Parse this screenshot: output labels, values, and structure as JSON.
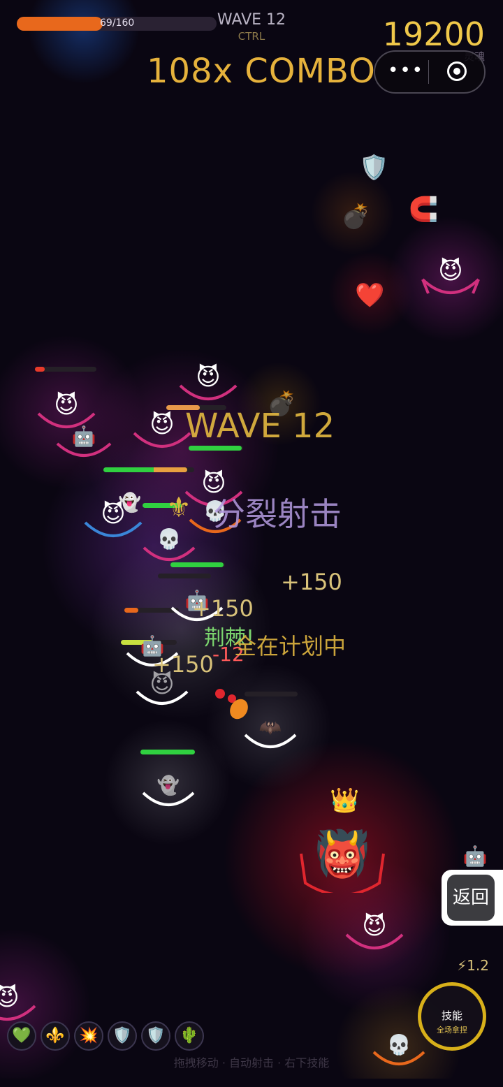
{
  "hud": {
    "hp_text": "69/160",
    "hp_fraction": 0.431,
    "wave_label": "WAVE 12",
    "wave_sub": "CTRL",
    "score": "19200",
    "score_unit": "灵魂",
    "combo": "108x COMBO"
  },
  "capsule": {
    "more_icon": "•••",
    "target_icon": "record-icon"
  },
  "floating": {
    "wave_banner": "WAVE 12",
    "skill_name": "分裂射击",
    "plus_a": "+150",
    "plus_b": "+150",
    "plus_c": "+150",
    "thorn": "荆棘!",
    "damage": "-12",
    "plan": "全在计划中"
  },
  "enemies": {
    "devil": "😈",
    "robot": "🤖",
    "skull": "💀",
    "ghost": "👻",
    "bat": "🦇",
    "boss": "👹",
    "crown": "👑"
  },
  "pickups": {
    "shield": "🛡️",
    "bomb": "💣",
    "magnet": "🧲",
    "heart": "❤️"
  },
  "skills_bar": [
    {
      "icon": "💚",
      "name": "heal"
    },
    {
      "icon": "⚜️",
      "name": "split"
    },
    {
      "icon": "💥",
      "name": "explode"
    },
    {
      "icon": "🛡️",
      "name": "shield"
    },
    {
      "icon": "🛡️",
      "name": "shield-2"
    },
    {
      "icon": "🌵",
      "name": "thorns"
    }
  ],
  "hint": "拖拽移动 · 自动射击 · 右下技能",
  "energy": "⚡1.2",
  "skill_button": {
    "line1": "技能",
    "line2": "全场拿捏"
  },
  "return_label": "返回",
  "colors": {
    "gold": "#e0b640",
    "magenta": "#d1307e",
    "blue": "#3a86d8",
    "red": "#e0262e",
    "white": "#ffffff",
    "orange": "#e8681c",
    "green": "#30d040"
  }
}
